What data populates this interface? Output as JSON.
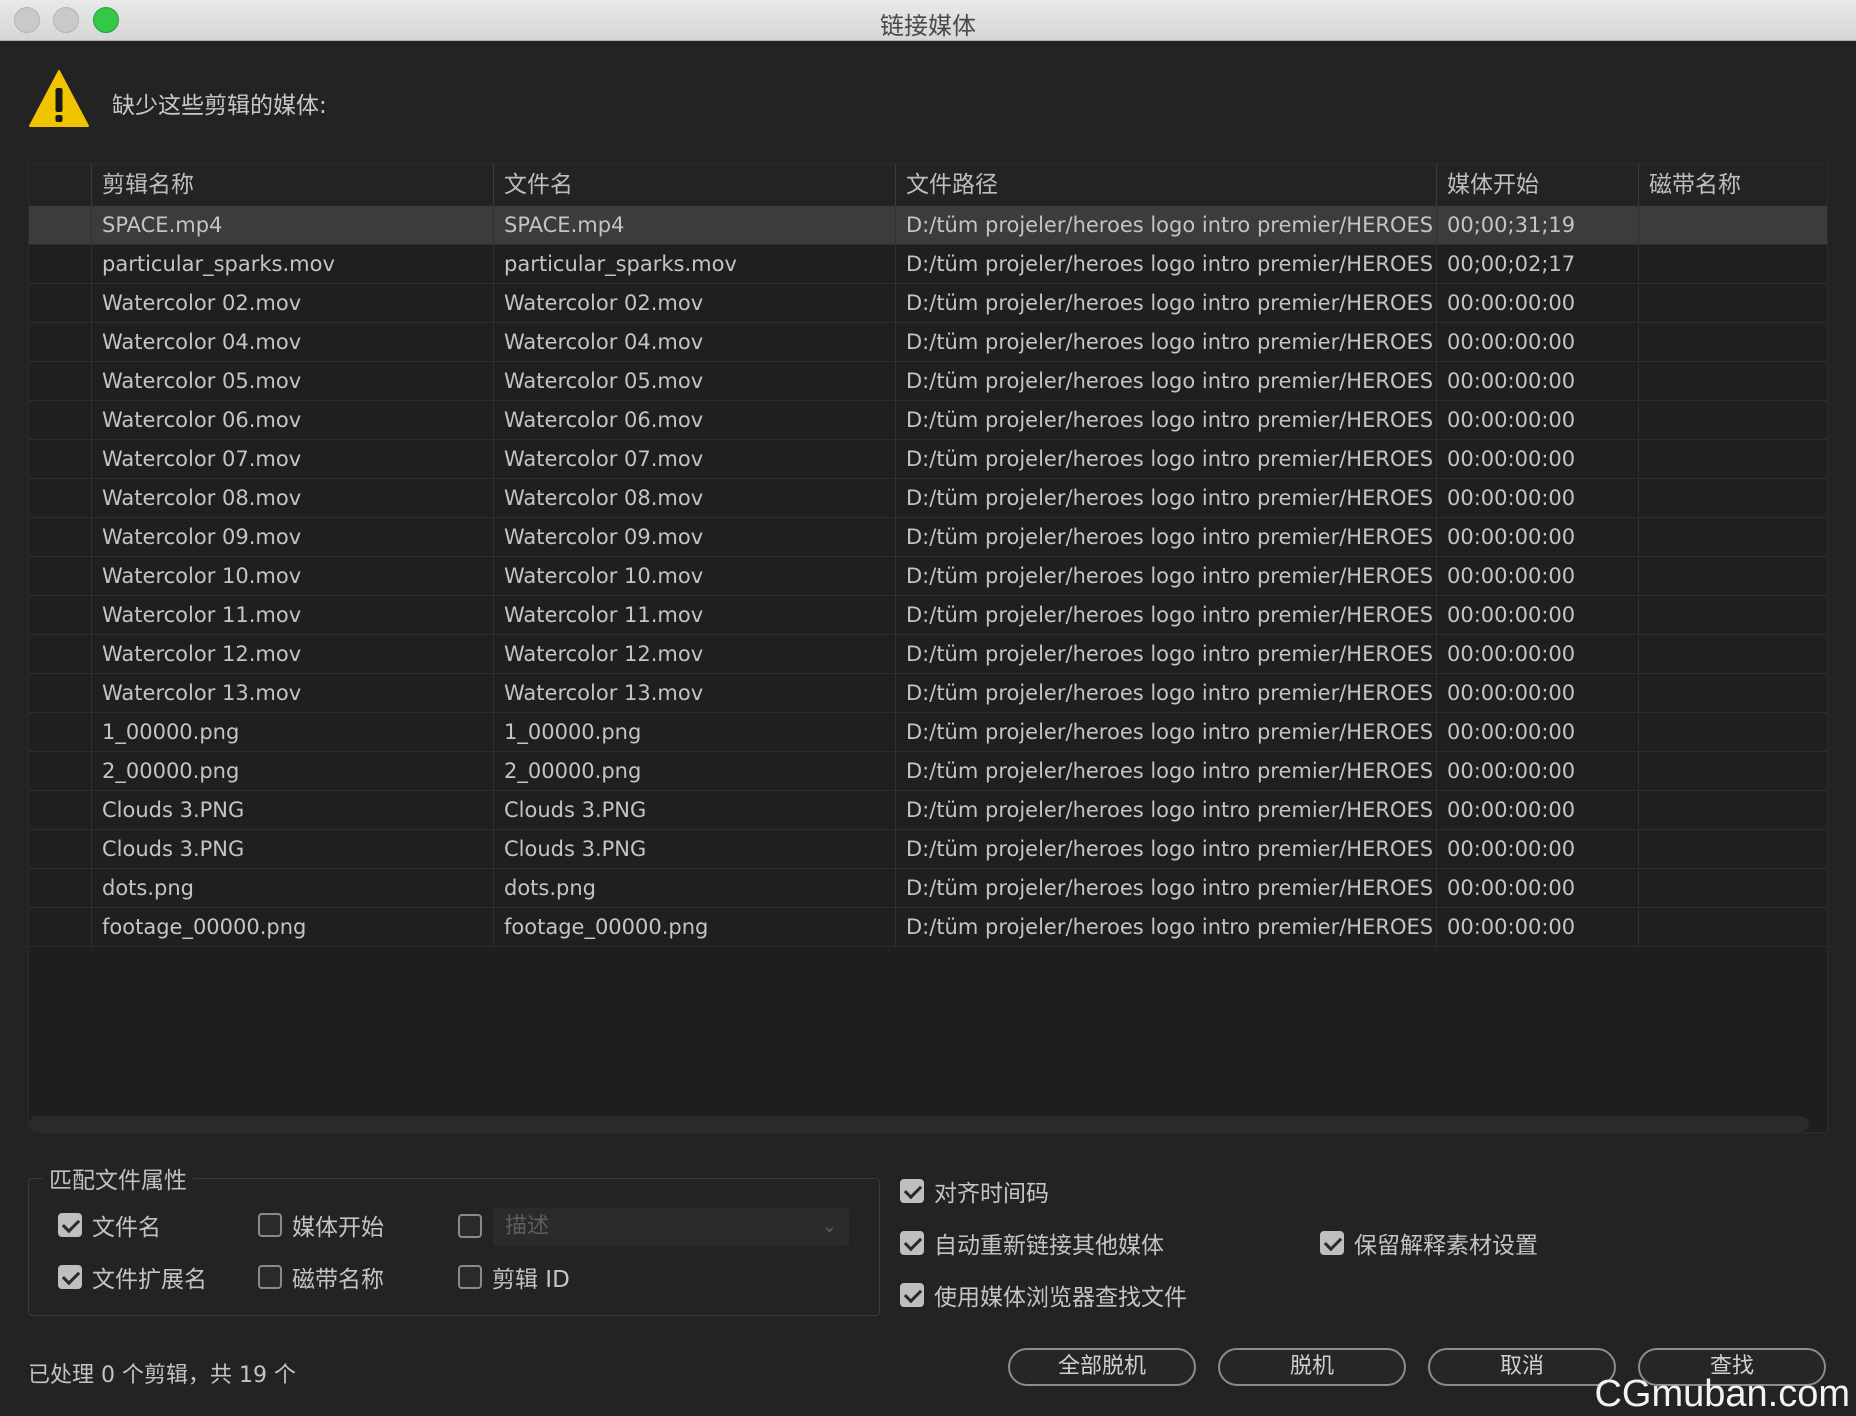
{
  "window": {
    "title": "链接媒体"
  },
  "message": {
    "text": "缺少这些剪辑的媒体:"
  },
  "table": {
    "columns": [
      "",
      "剪辑名称",
      "文件名",
      "文件路径",
      "媒体开始",
      "磁带名称"
    ],
    "rows": [
      [
        "SPACE.mp4",
        "SPACE.mp4",
        "D:/tüm projeler/heroes logo intro premier/HEROES LO",
        "00;00;31;19",
        ""
      ],
      [
        "particular_sparks.mov",
        "particular_sparks.mov",
        "D:/tüm projeler/heroes logo intro premier/HEROES LO",
        "00;00;02;17",
        ""
      ],
      [
        "Watercolor 02.mov",
        "Watercolor 02.mov",
        "D:/tüm projeler/heroes logo intro premier/HEROES LO",
        "00:00:00:00",
        ""
      ],
      [
        "Watercolor 04.mov",
        "Watercolor 04.mov",
        "D:/tüm projeler/heroes logo intro premier/HEROES LO",
        "00:00:00:00",
        ""
      ],
      [
        "Watercolor 05.mov",
        "Watercolor 05.mov",
        "D:/tüm projeler/heroes logo intro premier/HEROES LO",
        "00:00:00:00",
        ""
      ],
      [
        "Watercolor 06.mov",
        "Watercolor 06.mov",
        "D:/tüm projeler/heroes logo intro premier/HEROES LO",
        "00:00:00:00",
        ""
      ],
      [
        "Watercolor 07.mov",
        "Watercolor 07.mov",
        "D:/tüm projeler/heroes logo intro premier/HEROES LO",
        "00:00:00:00",
        ""
      ],
      [
        "Watercolor 08.mov",
        "Watercolor 08.mov",
        "D:/tüm projeler/heroes logo intro premier/HEROES LO",
        "00:00:00:00",
        ""
      ],
      [
        "Watercolor 09.mov",
        "Watercolor 09.mov",
        "D:/tüm projeler/heroes logo intro premier/HEROES LO",
        "00:00:00:00",
        ""
      ],
      [
        "Watercolor 10.mov",
        "Watercolor 10.mov",
        "D:/tüm projeler/heroes logo intro premier/HEROES LO",
        "00:00:00:00",
        ""
      ],
      [
        "Watercolor 11.mov",
        "Watercolor 11.mov",
        "D:/tüm projeler/heroes logo intro premier/HEROES LO",
        "00:00:00:00",
        ""
      ],
      [
        "Watercolor 12.mov",
        "Watercolor 12.mov",
        "D:/tüm projeler/heroes logo intro premier/HEROES LO",
        "00:00:00:00",
        ""
      ],
      [
        "Watercolor 13.mov",
        "Watercolor 13.mov",
        "D:/tüm projeler/heroes logo intro premier/HEROES LO",
        "00:00:00:00",
        ""
      ],
      [
        "1_00000.png",
        "1_00000.png",
        "D:/tüm projeler/heroes logo intro premier/HEROES LO",
        "00:00:00:00",
        ""
      ],
      [
        "2_00000.png",
        "2_00000.png",
        "D:/tüm projeler/heroes logo intro premier/HEROES LO",
        "00:00:00:00",
        ""
      ],
      [
        "Clouds 3.PNG",
        "Clouds 3.PNG",
        "D:/tüm projeler/heroes logo intro premier/HEROES LO",
        "00:00:00:00",
        ""
      ],
      [
        "Clouds 3.PNG",
        "Clouds 3.PNG",
        "D:/tüm projeler/heroes logo intro premier/HEROES LO",
        "00:00:00:00",
        ""
      ],
      [
        "dots.png",
        "dots.png",
        "D:/tüm projeler/heroes logo intro premier/HEROES LO",
        "00:00:00:00",
        ""
      ],
      [
        "footage_00000.png",
        "footage_00000.png",
        "D:/tüm projeler/heroes logo intro premier/HEROES LO",
        "00:00:00:00",
        ""
      ]
    ]
  },
  "match": {
    "legend": "匹配文件属性",
    "file_name": {
      "label": "文件名",
      "checked": true
    },
    "file_ext": {
      "label": "文件扩展名",
      "checked": true
    },
    "media_start": {
      "label": "媒体开始",
      "checked": false
    },
    "tape_name": {
      "label": "磁带名称",
      "checked": false
    },
    "description": {
      "label": "",
      "checked": false,
      "placeholder": "描述"
    },
    "clip_id": {
      "label": "剪辑 ID",
      "checked": false
    }
  },
  "options": {
    "align_timecode": {
      "label": "对齐时间码",
      "checked": true
    },
    "auto_relink": {
      "label": "自动重新链接其他媒体",
      "checked": true
    },
    "use_browser": {
      "label": "使用媒体浏览器查找文件",
      "checked": true
    },
    "preserve_interp": {
      "label": "保留解释素材设置",
      "checked": true
    }
  },
  "status": "已处理 0 个剪辑，共 19 个",
  "buttons": {
    "offline_all": "全部脱机",
    "offline": "脱机",
    "cancel": "取消",
    "locate": "查找"
  },
  "watermark": "CGmuban.com"
}
